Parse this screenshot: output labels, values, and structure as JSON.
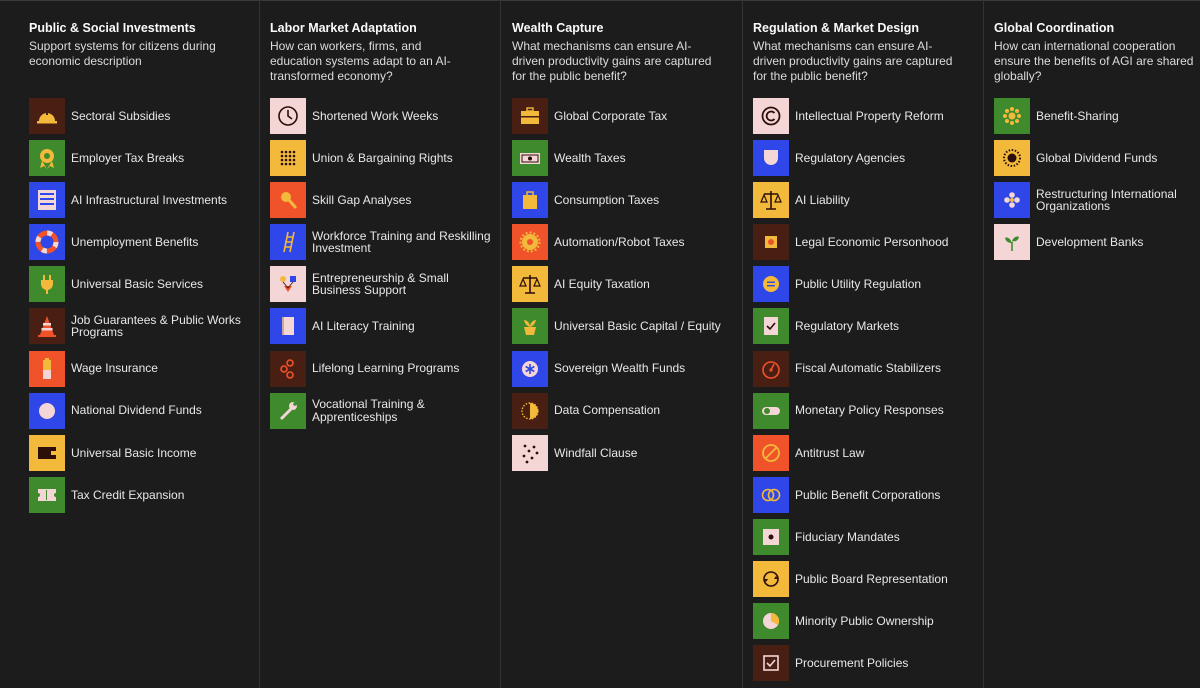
{
  "columns": [
    {
      "title": "Public & Social Investments",
      "description": "Support systems for citizens during economic description",
      "items": [
        {
          "label": "Sectoral Subsidies",
          "icon": "hard-hat-icon",
          "color": "#4a1f13"
        },
        {
          "label": "Employer Tax Breaks",
          "icon": "award-badge-icon",
          "color": "#3e8a2c"
        },
        {
          "label": "AI Infrastructural Investments",
          "icon": "server-rack-icon",
          "color": "#2f47e8"
        },
        {
          "label": "Unemployment Benefits",
          "icon": "life-ring-icon",
          "color": "#2f47e8"
        },
        {
          "label": "Universal Basic Services",
          "icon": "plug-icon",
          "color": "#3e8a2c"
        },
        {
          "label": "Job Guarantees & Public Works Programs",
          "icon": "traffic-cone-icon",
          "color": "#4a1f13"
        },
        {
          "label": "Wage Insurance",
          "icon": "battery-icon",
          "color": "#f0532a"
        },
        {
          "label": "National Dividend Funds",
          "icon": "circle-icon",
          "color": "#2f47e8"
        },
        {
          "label": "Universal Basic Income",
          "icon": "wallet-icon",
          "color": "#f2b93b"
        },
        {
          "label": "Tax Credit Expansion",
          "icon": "ticket-icon",
          "color": "#3e8a2c"
        }
      ]
    },
    {
      "title": "Labor Market Adaptation",
      "description": "How can workers, firms, and education systems adapt to an AI-transformed economy?",
      "items": [
        {
          "label": "Shortened Work Weeks",
          "icon": "clock-icon",
          "color": "#f4d6d6"
        },
        {
          "label": "Union & Bargaining Rights",
          "icon": "dot-grid-icon",
          "color": "#f2b93b"
        },
        {
          "label": "Skill Gap Analyses",
          "icon": "magnifier-icon",
          "color": "#f0532a"
        },
        {
          "label": "Workforce Training and Reskilling Investment",
          "icon": "ladder-icon",
          "color": "#2f47e8"
        },
        {
          "label": "Entrepreneurship & Small Business Support",
          "icon": "shapes-icon",
          "color": "#f4d6d6"
        },
        {
          "label": "AI Literacy Training",
          "icon": "book-icon",
          "color": "#2f47e8"
        },
        {
          "label": "Lifelong Learning Programs",
          "icon": "network-icon",
          "color": "#4a1f13"
        },
        {
          "label": "Vocational Training & Apprenticeships",
          "icon": "wrench-icon",
          "color": "#3e8a2c"
        }
      ]
    },
    {
      "title": "Wealth Capture",
      "description": "What mechanisms can ensure AI-driven productivity gains are captured for the public benefit?",
      "items": [
        {
          "label": "Global Corporate Tax",
          "icon": "briefcase-icon",
          "color": "#4a1f13"
        },
        {
          "label": "Wealth Taxes",
          "icon": "banknote-icon",
          "color": "#3e8a2c"
        },
        {
          "label": "Consumption Taxes",
          "icon": "shopping-bag-icon",
          "color": "#2f47e8"
        },
        {
          "label": "Automation/Robot Taxes",
          "icon": "gear-icon",
          "color": "#f0532a"
        },
        {
          "label": "AI Equity Taxation",
          "icon": "scales-icon",
          "color": "#f2b93b"
        },
        {
          "label": "Universal Basic Capital / Equity",
          "icon": "plant-pot-icon",
          "color": "#3e8a2c"
        },
        {
          "label": "Sovereign Wealth Funds",
          "icon": "star-circle-icon",
          "color": "#2f47e8"
        },
        {
          "label": "Data Compensation",
          "icon": "dotted-circle-icon",
          "color": "#4a1f13"
        },
        {
          "label": "Windfall Clause",
          "icon": "scattered-dots-icon",
          "color": "#f4d6d6"
        }
      ]
    },
    {
      "title": "Regulation & Market Design",
      "description": "What mechanisms can ensure AI-driven productivity gains are captured for the public benefit?",
      "items": [
        {
          "label": "Intellectual Property Reform",
          "icon": "copyright-icon",
          "color": "#f4d6d6"
        },
        {
          "label": "Regulatory Agencies",
          "icon": "shield-icon",
          "color": "#2f47e8"
        },
        {
          "label": "AI Liability",
          "icon": "scales-icon",
          "color": "#f2b93b"
        },
        {
          "label": "Legal Economic Personhood",
          "icon": "square-circle-icon",
          "color": "#4a1f13"
        },
        {
          "label": "Public Utility Regulation",
          "icon": "equals-circle-icon",
          "color": "#2f47e8"
        },
        {
          "label": "Regulatory Markets",
          "icon": "clipboard-check-icon",
          "color": "#3e8a2c"
        },
        {
          "label": "Fiscal Automatic Stabilizers",
          "icon": "gauge-icon",
          "color": "#4a1f13"
        },
        {
          "label": "Monetary Policy Responses",
          "icon": "toggle-icon",
          "color": "#3e8a2c"
        },
        {
          "label": "Antitrust Law",
          "icon": "prohibited-icon",
          "color": "#f0532a"
        },
        {
          "label": "Public Benefit Corporations",
          "icon": "linked-rings-icon",
          "color": "#2f47e8"
        },
        {
          "label": "Fiduciary Mandates",
          "icon": "framed-dot-icon",
          "color": "#3e8a2c"
        },
        {
          "label": "Public Board Representation",
          "icon": "cycle-arrows-icon",
          "color": "#f2b93b"
        },
        {
          "label": "Minority Public Ownership",
          "icon": "pie-chart-icon",
          "color": "#3e8a2c"
        },
        {
          "label": "Procurement Policies",
          "icon": "checkbox-icon",
          "color": "#4a1f13"
        }
      ]
    },
    {
      "title": "Global Coordination",
      "description": "How can international cooperation ensure the benefits of AGI are shared globally?",
      "items": [
        {
          "label": "Benefit-Sharing",
          "icon": "sun-icon",
          "color": "#3e8a2c"
        },
        {
          "label": "Global Dividend Funds",
          "icon": "sunburst-icon",
          "color": "#f2b93b"
        },
        {
          "label": "Restructuring International Organizations",
          "icon": "flower-icon",
          "color": "#2f47e8"
        },
        {
          "label": "Development Banks",
          "icon": "sprout-icon",
          "color": "#f4d6d6"
        }
      ]
    }
  ]
}
